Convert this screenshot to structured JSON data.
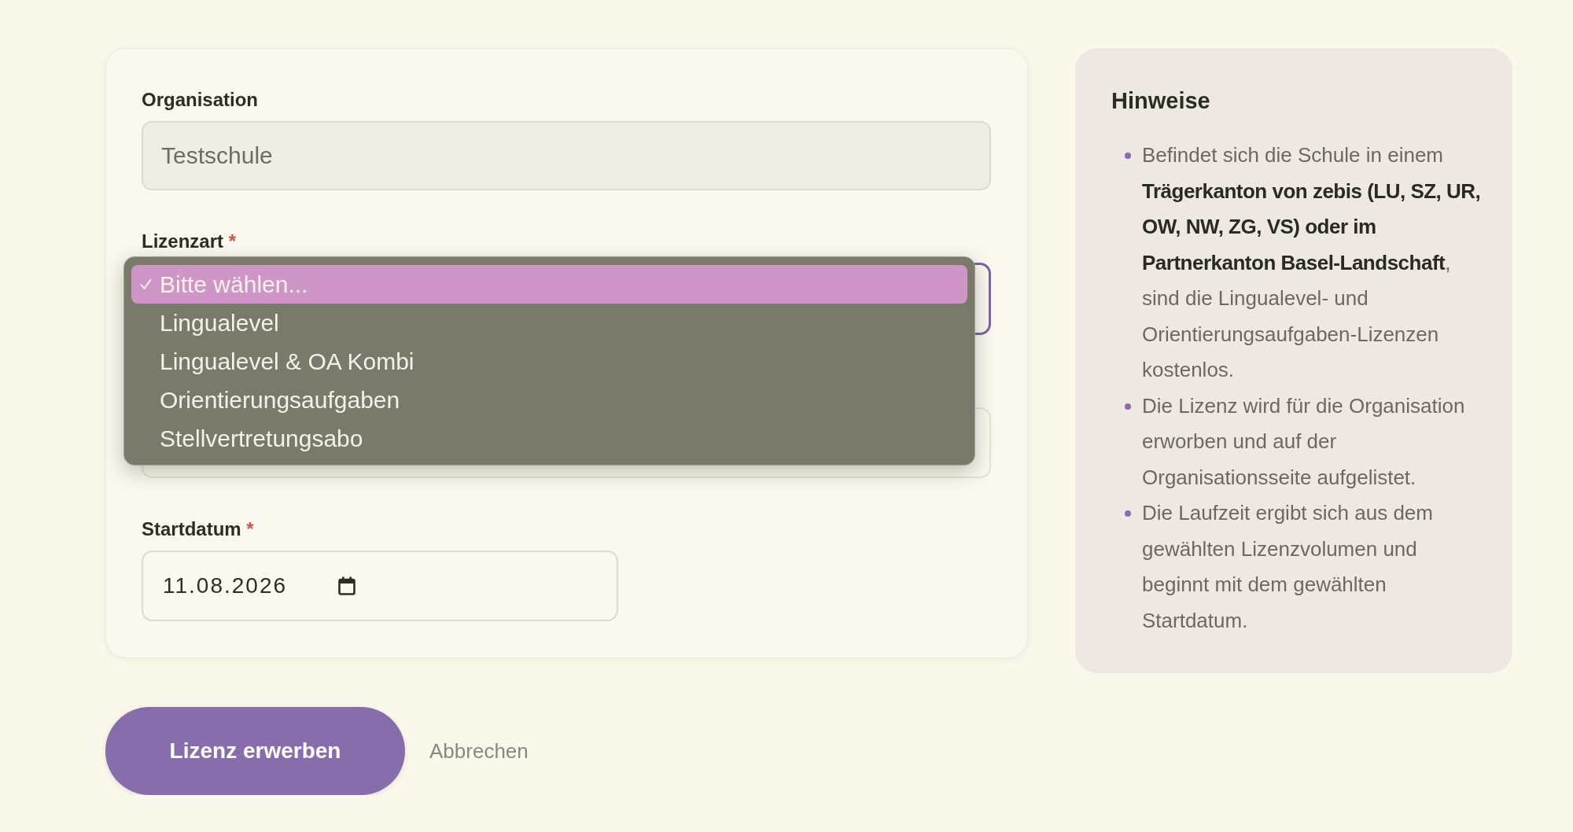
{
  "form": {
    "organisation": {
      "label": "Organisation",
      "value": "Testschule",
      "disabled": true
    },
    "license_type": {
      "label": "Lizenzart",
      "required_mark": "*",
      "expanded": true,
      "options": [
        {
          "label": "Bitte wählen...",
          "selected": true
        },
        {
          "label": "Lingualevel",
          "selected": false
        },
        {
          "label": "Lingualevel & OA Kombi",
          "selected": false
        },
        {
          "label": "Orientierungsaufgaben",
          "selected": false
        },
        {
          "label": "Stellvertretungsabo",
          "selected": false
        }
      ]
    },
    "start_date": {
      "label": "Startdatum",
      "required_mark": "*",
      "value": "11.08.2026"
    }
  },
  "notes": {
    "title": "Hinweise",
    "items": [
      "Befindet sich die Schule in einem **Trägerkanton von zebis (LU, SZ, UR, OW, NW, ZG, VS) oder im Partnerkanton Basel-Landschaft**, sind die Lingualevel- und Orientierungsaufgaben-Lizenzen kostenlos.",
      "Die Lizenz wird für die Organisation erworben und auf der Organisationsseite aufgelistet.",
      "Die Laufzeit ergibt sich aus dem gewählten Lizenzvolumen und beginnt mit dem gewählten Startdatum."
    ]
  },
  "actions": {
    "submit": "Lizenz erwerben",
    "cancel": "Abbrechen"
  }
}
